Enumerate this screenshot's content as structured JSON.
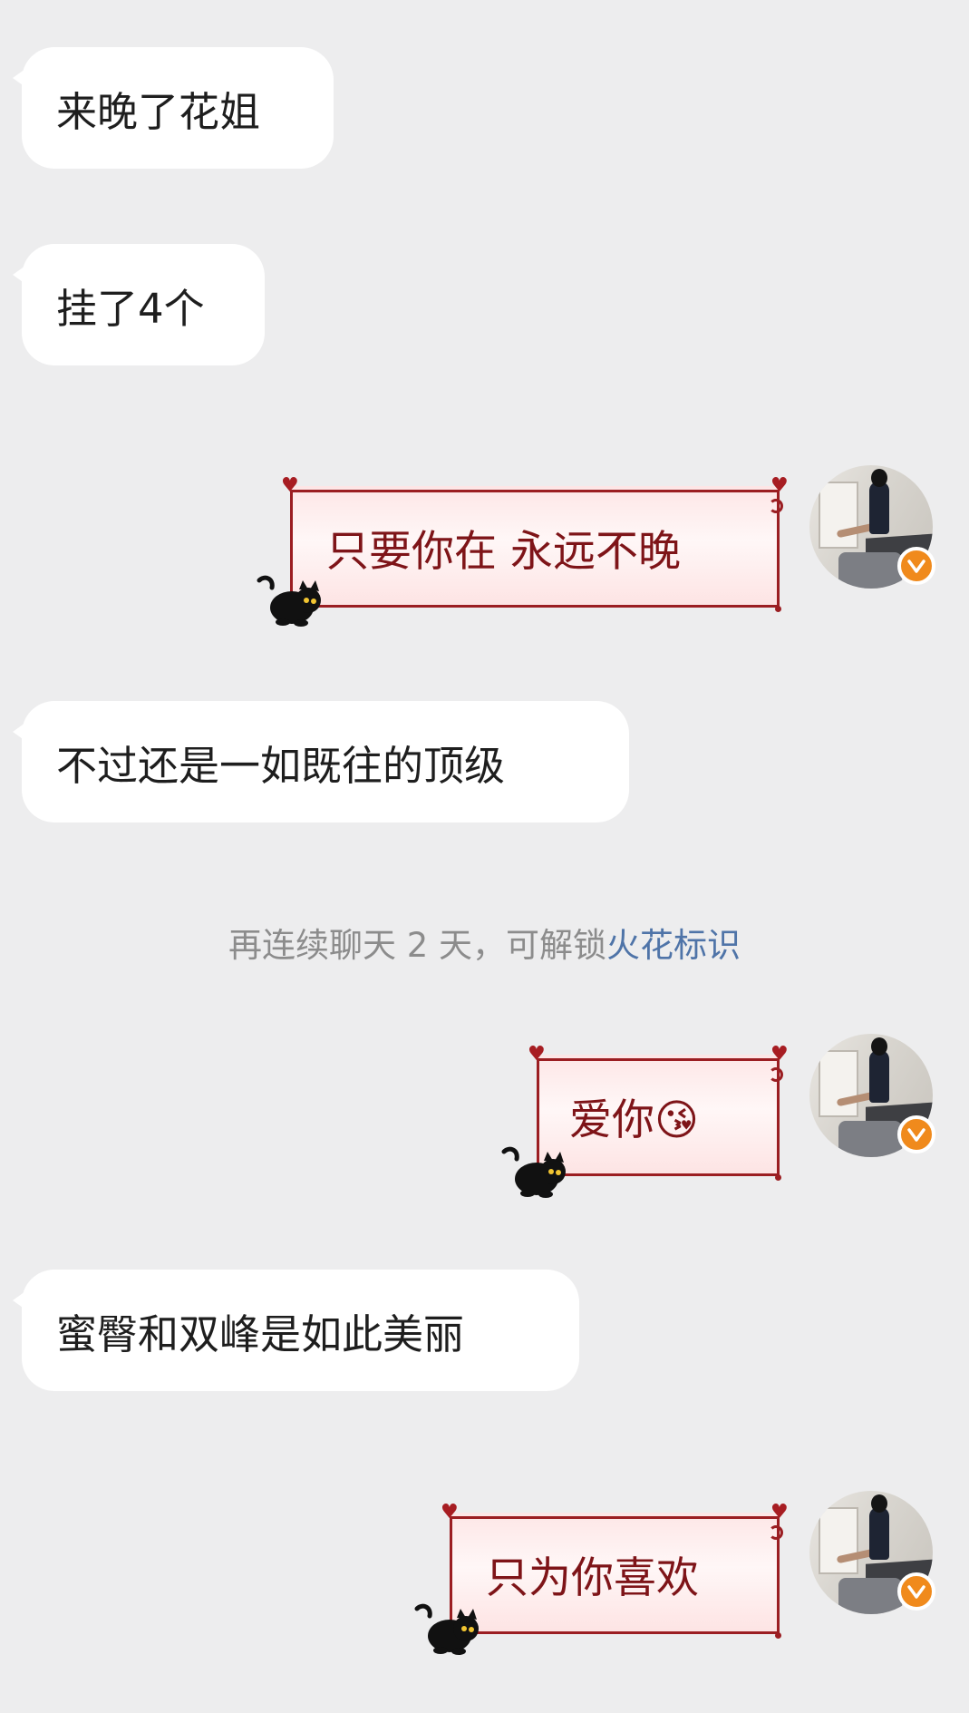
{
  "messages": [
    {
      "id": "m1",
      "direction": "incoming",
      "text": "来晚了花姐"
    },
    {
      "id": "m2",
      "direction": "incoming",
      "text": "挂了4个"
    },
    {
      "id": "m3",
      "direction": "outgoing",
      "text": "只要你在 永远不晚"
    },
    {
      "id": "m4",
      "direction": "incoming",
      "text": "不过还是一如既往的顶级"
    },
    {
      "id": "m5",
      "direction": "outgoing",
      "text": "爱你😘"
    },
    {
      "id": "m6",
      "direction": "incoming",
      "text": "蜜臀和双峰是如此美丽"
    },
    {
      "id": "m7",
      "direction": "outgoing",
      "text": "只为你喜欢"
    }
  ],
  "system_tip": {
    "prefix": "再连续聊天 2 天，可解锁",
    "link": "火花标识"
  },
  "icons": {
    "verified_badge": "verified-badge-icon",
    "sticker": "black-cat-icon",
    "heart": "heart-icon"
  },
  "colors": {
    "background": "#ededee",
    "incoming_bubble": "#ffffff",
    "outgoing_frame": "#9b1e22",
    "outgoing_text": "#7e1418",
    "link": "#4f74a8",
    "badge": "#f08a1c"
  }
}
